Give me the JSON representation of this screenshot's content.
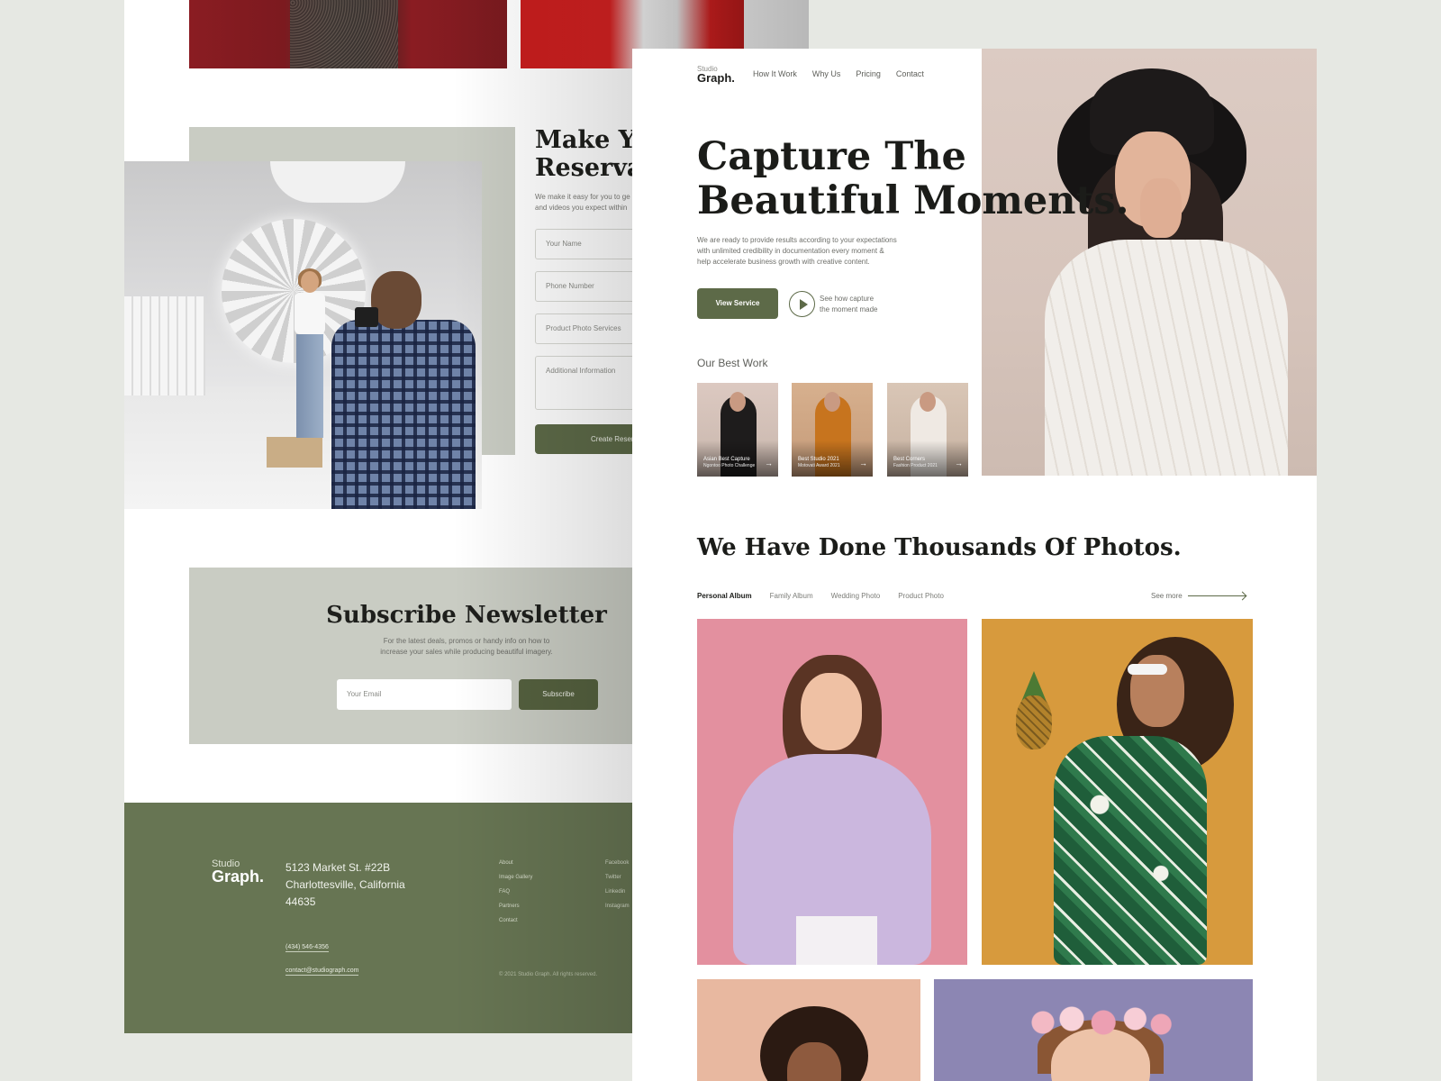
{
  "back_page": {
    "reservation": {
      "title": "Make Yo\nReservat",
      "description": "We make it easy for you to ge\nand videos you expect within",
      "fields": {
        "name_placeholder": "Your Name",
        "phone_placeholder": "Phone Number",
        "service_placeholder": "Product Photo Services",
        "info_placeholder": "Additional Information"
      },
      "submit_label": "Create Reser"
    },
    "newsletter": {
      "title": "Subscribe Newsletter",
      "description": "For the latest deals, promos or handy info on how to\nincrease your sales while producing beautiful imagery.",
      "email_placeholder": "Your Email",
      "subscribe_label": "Subscribe"
    },
    "footer": {
      "logo_small": "Studio",
      "logo": "Graph.",
      "address": "5123 Market St. #22B\nCharlottesville, California\n44635",
      "phone": "(434) 546-4356",
      "email": "contact@studiograph.com",
      "links": [
        "About",
        "Image Gallery",
        "FAQ",
        "Partners",
        "Contact"
      ],
      "social": [
        "Facebook",
        "Twitter",
        "Linkedin",
        "Instagram"
      ],
      "copyright": "© 2021 Studio Graph. All rights reserved."
    }
  },
  "front_page": {
    "logo_small": "Studio",
    "logo": "Graph.",
    "nav": [
      "How It Work",
      "Why Us",
      "Pricing",
      "Contact"
    ],
    "hero": {
      "title": "Capture The\nBeautiful Moments.",
      "description": "We are ready to provide results according to your expectations\nwith unlimited credibility in documentation every moment &\nhelp accelerate business growth with creative content.",
      "cta_label": "View Service",
      "play_text": "See how capture\nthe moment made"
    },
    "best_work": {
      "title": "Our Best Work",
      "items": [
        {
          "caption": "Asian Best Capture",
          "sub": "Ngontoo Photo Challenge"
        },
        {
          "caption": "Best Studio 2021",
          "sub": "Motovati Award 2021"
        },
        {
          "caption": "Best Corners",
          "sub": "Fashion Product 2021"
        }
      ]
    },
    "gallery": {
      "title": "We Have Done Thousands Of Photos.",
      "tabs": [
        "Personal Album",
        "Family Album",
        "Wedding Photo",
        "Product Photo"
      ],
      "see_more": "See more"
    }
  },
  "colors": {
    "accent": "#5d6a48",
    "footer": "#677553",
    "panel": "#c9ccc3",
    "background": "#e6e8e3"
  }
}
